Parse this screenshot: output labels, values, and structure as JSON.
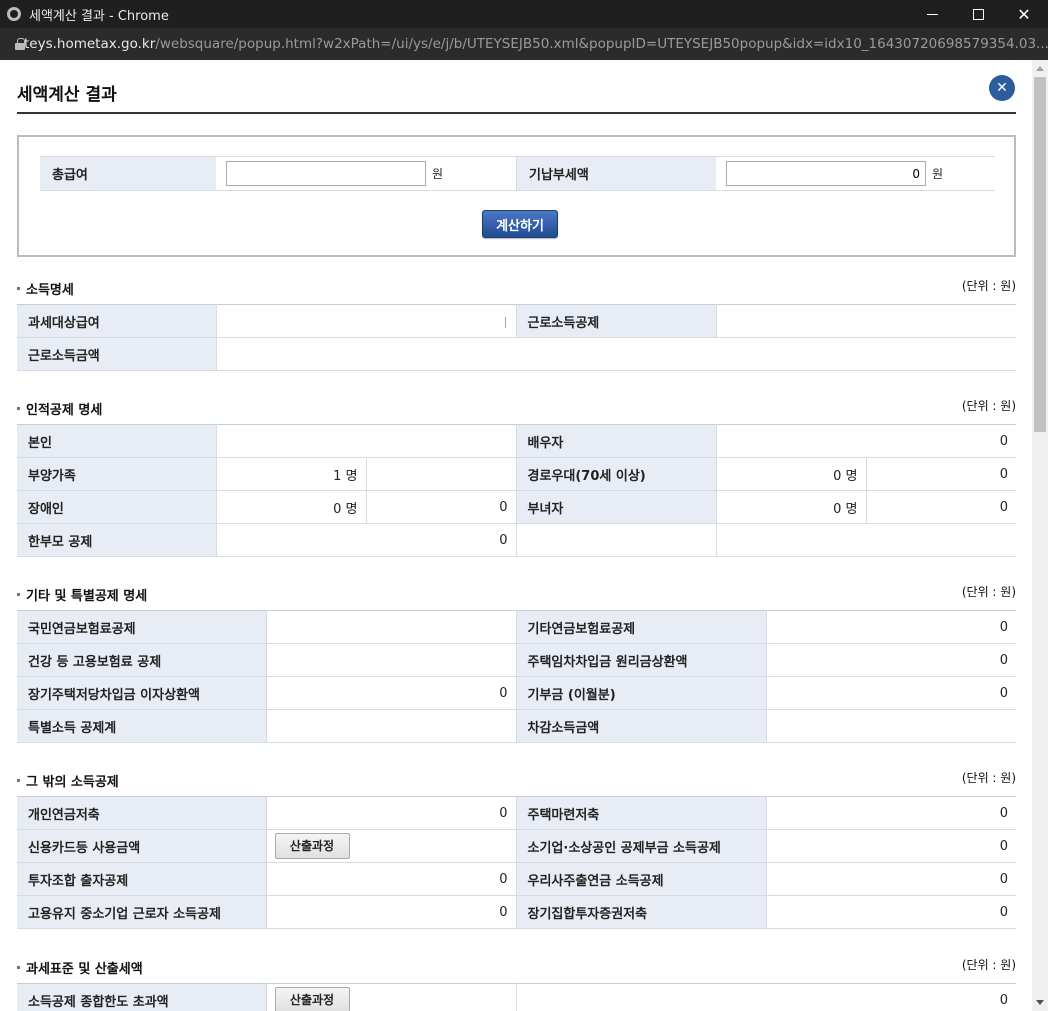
{
  "window": {
    "title": "세액계산 결과 - Chrome",
    "url_host": "teys.hometax.go.kr",
    "url_path": "/websquare/popup.html?w2xPath=/ui/ys/e/j/b/UTEYSEJB50.xml&popupID=UTEYSEJB50popup&idx=idx10_16430720698579354.03..."
  },
  "popup": {
    "title": "세액계산 결과",
    "close_symbol": "✕"
  },
  "inputs": {
    "gross_pay_label": "총급여",
    "gross_pay_value": "",
    "prepaid_tax_label": "기납부세액",
    "prepaid_tax_value": "0",
    "unit": "원",
    "calculate_label": "계산하기"
  },
  "unit_note": "(단위 : 원)",
  "calc_process_label": "산출과정",
  "income_detail": {
    "title": "소득명세",
    "taxable_pay_label": "과세대상급여",
    "taxable_pay_value": "",
    "earned_income_deduction_label": "근로소득공제",
    "earned_income_deduction_value": "",
    "earned_income_amount_label": "근로소득금액",
    "earned_income_amount_value": ""
  },
  "personal_deduction": {
    "title": "인적공제 명세",
    "self_label": "본인",
    "self_value": "",
    "spouse_label": "배우자",
    "spouse_value": "0",
    "dependents_label": "부양가족",
    "dependents_count": "1 명",
    "dependents_value": "",
    "elderly_label": "경로우대(70세 이상)",
    "elderly_count": "0 명",
    "elderly_value": "0",
    "disabled_label": "장애인",
    "disabled_count": "0 명",
    "disabled_value": "0",
    "woman_label": "부녀자",
    "woman_count": "0 명",
    "woman_value": "0",
    "single_parent_label": "한부모 공제",
    "single_parent_value": "0"
  },
  "other_special_deduction": {
    "title": "기타 및 특별공제 명세",
    "national_pension_label": "국민연금보험료공제",
    "national_pension_value": "",
    "other_pension_label": "기타연금보험료공제",
    "other_pension_value": "0",
    "health_insurance_label": "건강 등 고용보험료 공제",
    "health_insurance_value": "",
    "housing_lease_label": "주택임차차입금 원리금상환액",
    "housing_lease_value": "0",
    "mortgage_interest_label": "장기주택저당차입금 이자상환액",
    "mortgage_interest_value": "0",
    "donation_label": "기부금 (이월분)",
    "donation_value": "0",
    "special_total_label": "특별소득 공제계",
    "special_total_value": "",
    "deducted_income_label": "차감소득금액",
    "deducted_income_value": ""
  },
  "other_income_deduction": {
    "title": "그 밖의 소득공제",
    "personal_pension_label": "개인연금저축",
    "personal_pension_value": "0",
    "housing_savings_label": "주택마련저축",
    "housing_savings_value": "0",
    "credit_card_label": "신용카드등 사용금액",
    "small_business_label": "소기업·소상공인 공제부금 소득공제",
    "small_business_value": "0",
    "investment_label": "투자조합 출자공제",
    "investment_value": "0",
    "esop_label": "우리사주출연금 소득공제",
    "esop_value": "0",
    "sme_employee_label": "고용유지 중소기업 근로자 소득공제",
    "sme_employee_value": "0",
    "long_term_fund_label": "장기집합투자증권저축",
    "long_term_fund_value": "0"
  },
  "tax_base": {
    "title": "과세표준 및 산출세액",
    "limit_excess_label": "소득공제 종합한도 초과액",
    "limit_excess_value": "0"
  }
}
